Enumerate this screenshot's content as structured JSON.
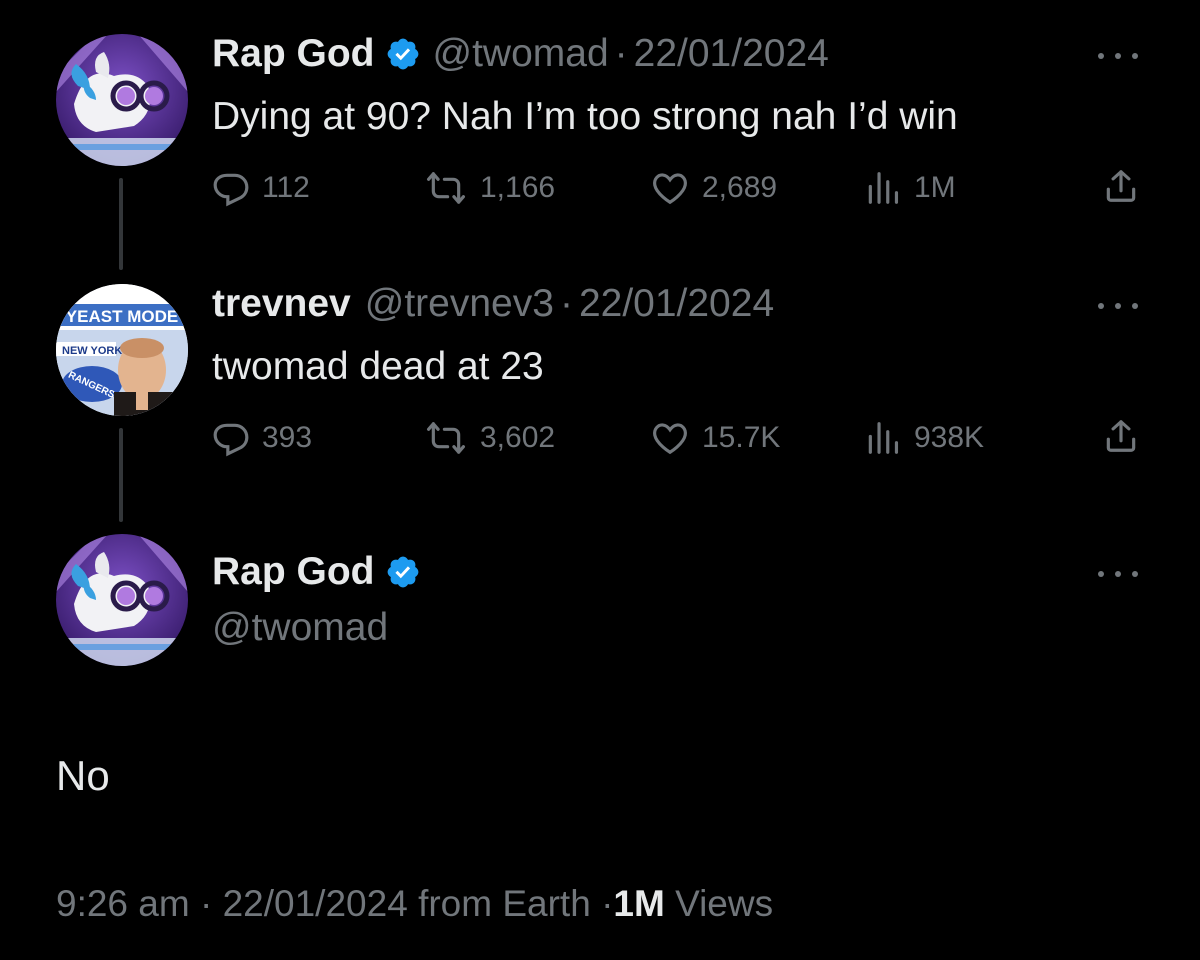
{
  "tweets": [
    {
      "name": "Rap God",
      "verified": true,
      "handle": "@twomad",
      "separator": "·",
      "date": "22/01/2024",
      "text": "Dying at 90? Nah I’m too strong nah I’d win",
      "stats": {
        "replies": "112",
        "reposts": "1,166",
        "likes": "2,689",
        "views": "1M"
      }
    },
    {
      "name": "trevnev",
      "verified": false,
      "handle": "@trevnev3",
      "separator": "·",
      "date": "22/01/2024",
      "text": "twomad dead at 23",
      "avatar_text": {
        "top": "YEAST MODE",
        "left": "NEW YORK",
        "badge": "RANGERS"
      },
      "stats": {
        "replies": "393",
        "reposts": "3,602",
        "likes": "15.7K",
        "views": "938K"
      }
    }
  ],
  "main_tweet": {
    "name": "Rap God",
    "verified": true,
    "handle": "@twomad",
    "text": "No",
    "time": "9:26 am",
    "separator": "·",
    "date": "22/01/2024",
    "source": "from Earth",
    "views_count": "1M",
    "views_label": "Views"
  },
  "icons": [
    "reply-icon",
    "repost-icon",
    "like-icon",
    "views-icon",
    "share-icon",
    "more-icon",
    "verified-badge-icon"
  ],
  "colors": {
    "background": "#000000",
    "text": "#e7e9ea",
    "muted": "#71767b",
    "verified": "#1d9bf0",
    "line": "#333639"
  }
}
